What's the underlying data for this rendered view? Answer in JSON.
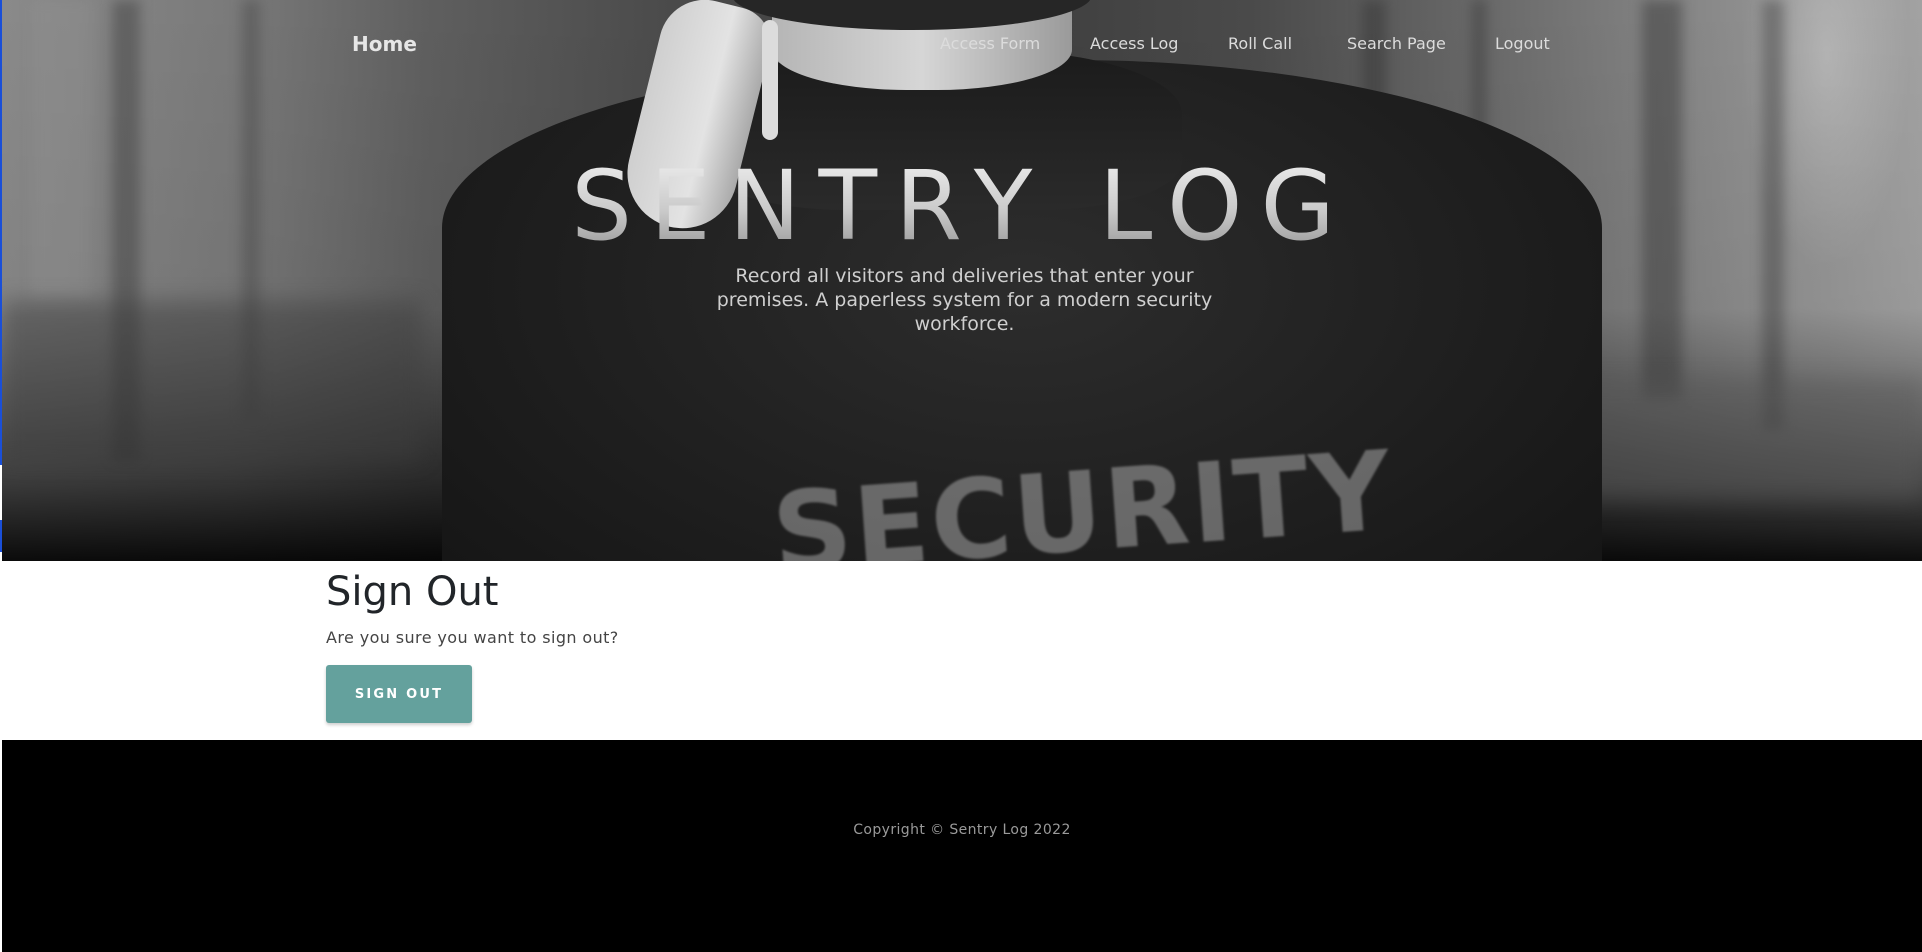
{
  "nav": {
    "home_label": "Home",
    "links": [
      {
        "label": "Access Form"
      },
      {
        "label": "Access Log"
      },
      {
        "label": "Roll Call"
      },
      {
        "label": "Search Page"
      },
      {
        "label": "Logout"
      }
    ]
  },
  "hero": {
    "title": "SENTRY LOG",
    "subtitle": "Record all visitors and deliveries that enter your premises. A paperless system for a modern security workforce.",
    "image_text": "SECURITY"
  },
  "main": {
    "title": "Sign Out",
    "prompt": "Are you sure you want to sign out?",
    "button_label": "SIGN OUT"
  },
  "footer": {
    "copyright": "Copyright © Sentry Log 2022"
  },
  "colors": {
    "accent": "#64a19d",
    "footer_bg": "#000000",
    "text_dark": "#212529"
  }
}
